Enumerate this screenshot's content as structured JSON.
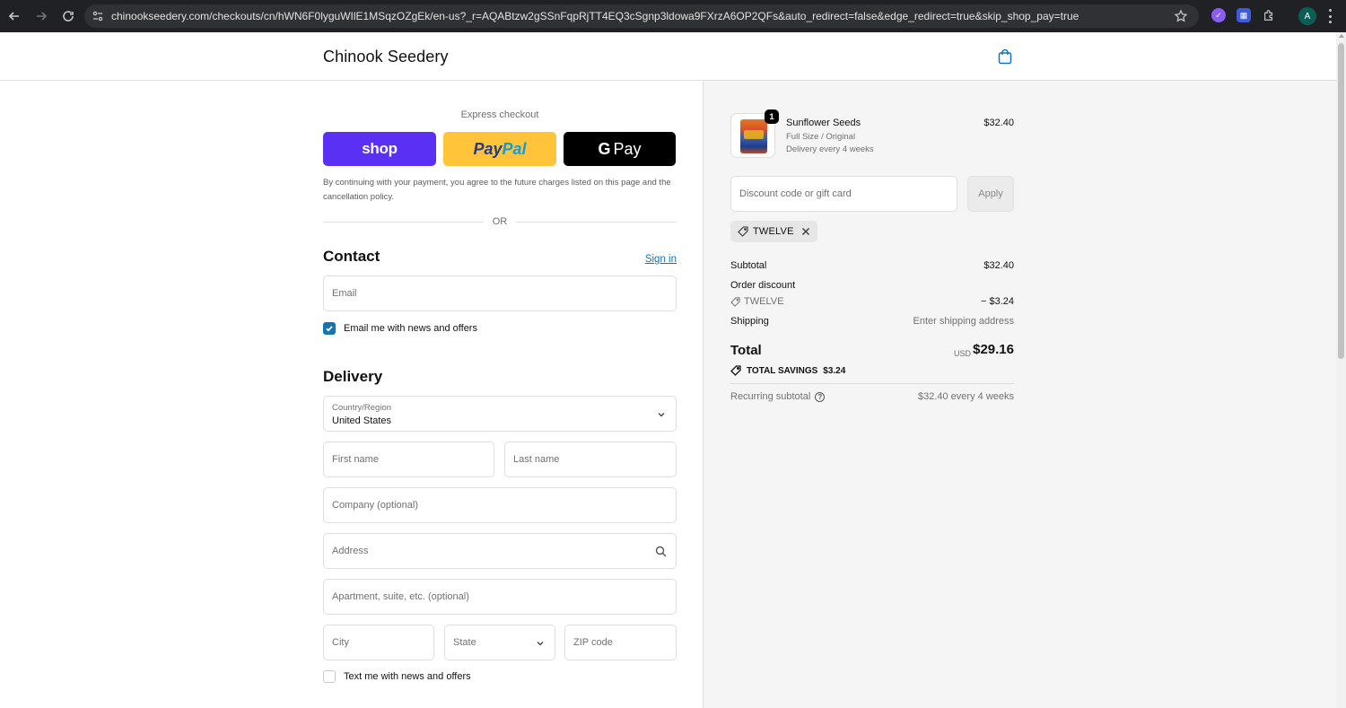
{
  "browser": {
    "url": "chinookseedery.com/checkouts/cn/hWN6F0lyguWIlE1MSqzOZgEk/en-us?_r=AQABtzw2gSSnFqpRjTT4EQ3cSgnp3ldowa9FXrzA6OP2QFs&auto_redirect=false&edge_redirect=true&skip_shop_pay=true",
    "profile_initial": "A"
  },
  "header": {
    "store_name": "Chinook Seedery"
  },
  "express": {
    "title": "Express checkout",
    "shop_label": "shop",
    "paypal_part1": "Pay",
    "paypal_part2": "Pal",
    "gpay_g": "G",
    "gpay_label": "Pay",
    "consent": "By continuing with your payment, you agree to the future charges listed on this page and the cancellation policy.",
    "or_label": "OR"
  },
  "contact": {
    "title": "Contact",
    "sign_in": "Sign in",
    "email_placeholder": "Email",
    "news_checkbox_label": "Email me with news and offers",
    "news_checked": true
  },
  "delivery": {
    "title": "Delivery",
    "country_label": "Country/Region",
    "country_value": "United States",
    "first_name_placeholder": "First name",
    "last_name_placeholder": "Last name",
    "company_placeholder": "Company (optional)",
    "address_placeholder": "Address",
    "apartment_placeholder": "Apartment, suite, etc. (optional)",
    "city_placeholder": "City",
    "state_placeholder": "State",
    "zip_placeholder": "ZIP code",
    "text_checkbox_label": "Text me with news and offers",
    "text_checked": false
  },
  "summary": {
    "item": {
      "name": "Sunflower Seeds",
      "variant": "Full Size / Original",
      "delivery": "Delivery every 4 weeks",
      "price": "$32.40",
      "quantity": "1"
    },
    "discount_placeholder": "Discount code or gift card",
    "apply_label": "Apply",
    "applied_code": "TWELVE",
    "subtotal_label": "Subtotal",
    "subtotal_value": "$32.40",
    "order_discount_label": "Order discount",
    "discount_code_label": "TWELVE",
    "discount_value": "− $3.24",
    "shipping_label": "Shipping",
    "shipping_value": "Enter shipping address",
    "total_label": "Total",
    "currency": "USD",
    "total_value": "$29.16",
    "savings_label": "TOTAL SAVINGS",
    "savings_value": "$3.24",
    "recurring_label": "Recurring subtotal",
    "recurring_help": "?",
    "recurring_value": "$32.40 every 4 weeks"
  },
  "colors": {
    "accent": "#1773b0",
    "shop_pay": "#5a31f4",
    "paypal": "#ffc439",
    "summary_bg": "#f5f5f5"
  }
}
